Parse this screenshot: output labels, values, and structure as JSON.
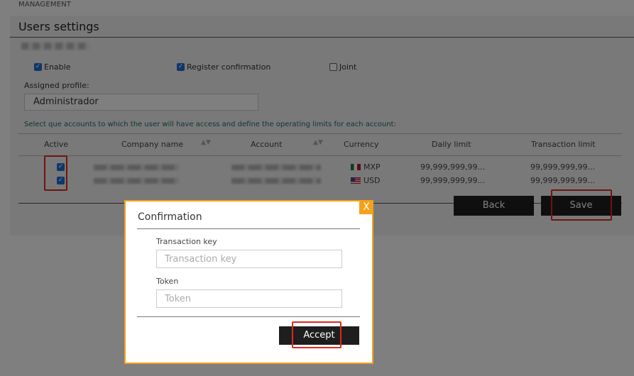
{
  "header": {
    "section": "MANAGEMENT",
    "title": "Users settings"
  },
  "options": {
    "enable_label": "Enable",
    "enable_checked": true,
    "register_label": "Register confirmation",
    "register_checked": true,
    "joint_label": "Joint",
    "joint_checked": false
  },
  "profile": {
    "label": "Assigned profile:",
    "value": "Administrador"
  },
  "accounts": {
    "instruction": "Select que accounts to which the user will have access and define the operating limits for each account:",
    "columns": [
      "Active",
      "Company name",
      "Account",
      "Currency",
      "Daily limit",
      "Transaction limit"
    ],
    "rows": [
      {
        "active": true,
        "currency": "MXP",
        "flag": "mexico-flag-icon",
        "daily_limit": "99,999,999,99...",
        "transaction_limit": "99,999,999,99..."
      },
      {
        "active": true,
        "currency": "USD",
        "flag": "usa-flag-icon",
        "daily_limit": "99,999,999,99...",
        "transaction_limit": "99,999,999,99..."
      }
    ]
  },
  "actions": {
    "back_label": "Back",
    "save_label": "Save"
  },
  "modal": {
    "title": "Confirmation",
    "close_label": "X",
    "transaction_key_label": "Transaction key",
    "transaction_key_placeholder": "Transaction key",
    "token_label": "Token",
    "token_placeholder": "Token",
    "accept_label": "Accept"
  },
  "colors": {
    "modal_border": "#f5a11a",
    "highlight": "#e0281b",
    "checkbox": "#1f6fd6",
    "instruction_text": "#1a6f6a"
  }
}
